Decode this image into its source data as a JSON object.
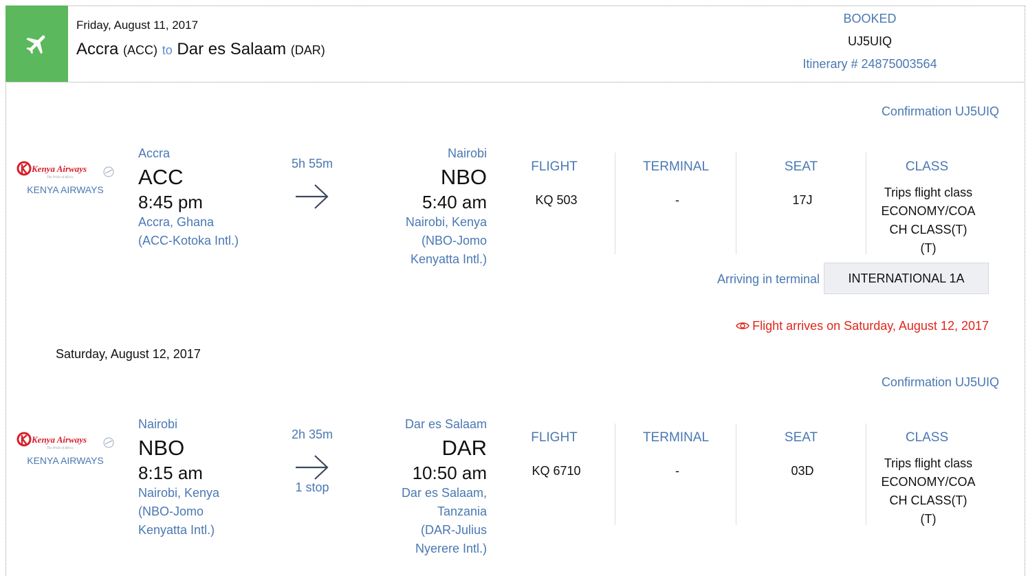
{
  "header": {
    "date": "Friday, August 11, 2017",
    "origin_city": "Accra",
    "origin_code": "(ACC)",
    "connector": "to",
    "dest_city": "Dar es Salaam",
    "dest_code": "(DAR)",
    "status": "BOOKED",
    "confirmation": "UJ5UIQ",
    "itinerary": "Itinerary # 24875003564",
    "icon": "airplane-icon",
    "accent_color": "#5cb85c"
  },
  "segments": [
    {
      "confirmation": "Confirmation UJ5UIQ",
      "airline": "KENYA AIRWAYS",
      "depart_city": "Accra",
      "depart_code": "ACC",
      "depart_time": "8:45 pm",
      "depart_place_1": "Accra, Ghana",
      "depart_place_2": "(ACC-Kotoka Intl.)",
      "duration": "5h 55m",
      "stops": "",
      "arrive_city": "Nairobi",
      "arrive_code": "NBO",
      "arrive_time": "5:40 am",
      "arrive_place_1": "Nairobi, Kenya",
      "arrive_place_2": "(NBO-Jomo",
      "arrive_place_3": "Kenyatta Intl.)",
      "arrive_place_4": "",
      "flight_label": "FLIGHT",
      "flight": "KQ 503",
      "terminal_label": "TERMINAL",
      "terminal": "-",
      "seat_label": "SEAT",
      "seat": "17J",
      "class_label": "CLASS",
      "class_1": "Trips flight class",
      "class_2": "ECONOMY/COA",
      "class_3": "CH CLASS(T)",
      "class_4": "(T)",
      "arriving_terminal_label": "Arriving in terminal",
      "arriving_terminal": "INTERNATIONAL 1A",
      "arrival_note": "Flight arrives on Saturday, August 12, 2017"
    },
    {
      "day_label": "Saturday, August 12, 2017",
      "confirmation": "Confirmation UJ5UIQ",
      "airline": "KENYA AIRWAYS",
      "depart_city": "Nairobi",
      "depart_code": "NBO",
      "depart_time": "8:15 am",
      "depart_place_1": "Nairobi, Kenya",
      "depart_place_2": "(NBO-Jomo",
      "depart_place_3": "Kenyatta Intl.)",
      "duration": "2h 35m",
      "stops": "1 stop",
      "arrive_city": "Dar es Salaam",
      "arrive_code": "DAR",
      "arrive_time": "10:50 am",
      "arrive_place_1": "Dar es Salaam,",
      "arrive_place_2": "Tanzania",
      "arrive_place_3": "(DAR-Julius",
      "arrive_place_4": "Nyerere Intl.)",
      "flight_label": "FLIGHT",
      "flight": "KQ 6710",
      "terminal_label": "TERMINAL",
      "terminal": "-",
      "seat_label": "SEAT",
      "seat": "03D",
      "class_label": "CLASS",
      "class_1": "Trips flight class",
      "class_2": "ECONOMY/COA",
      "class_3": "CH CLASS(T)",
      "class_4": "(T)"
    }
  ],
  "logo_text": "Kenya Airways",
  "logo_tagline": "The Pride of Africa",
  "colors": {
    "link_blue": "#4a78b2",
    "alert_red": "#e0261b",
    "logo_red": "#d81e2a"
  }
}
